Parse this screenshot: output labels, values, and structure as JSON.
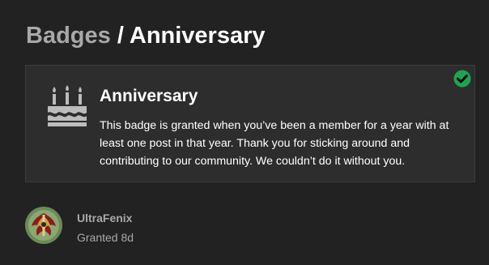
{
  "breadcrumb": {
    "parent": "Badges",
    "separator": "/",
    "current": "Anniversary"
  },
  "badge": {
    "title": "Anniversary",
    "description": "This badge is granted when you’ve been a member for a year with at least one post in that year. Thank you for sticking around and contributing to our community. We couldn’t do it without you.",
    "icon": "birthday-cake-icon",
    "granted_icon": "check-circle-icon",
    "granted_color": "#1ca551"
  },
  "grantees": [
    {
      "username": "UltraFenix",
      "granted": "Granted 8d"
    }
  ],
  "colors": {
    "background": "#222222",
    "card": "#2d2d2d",
    "muted_text": "#a8a8a8"
  }
}
